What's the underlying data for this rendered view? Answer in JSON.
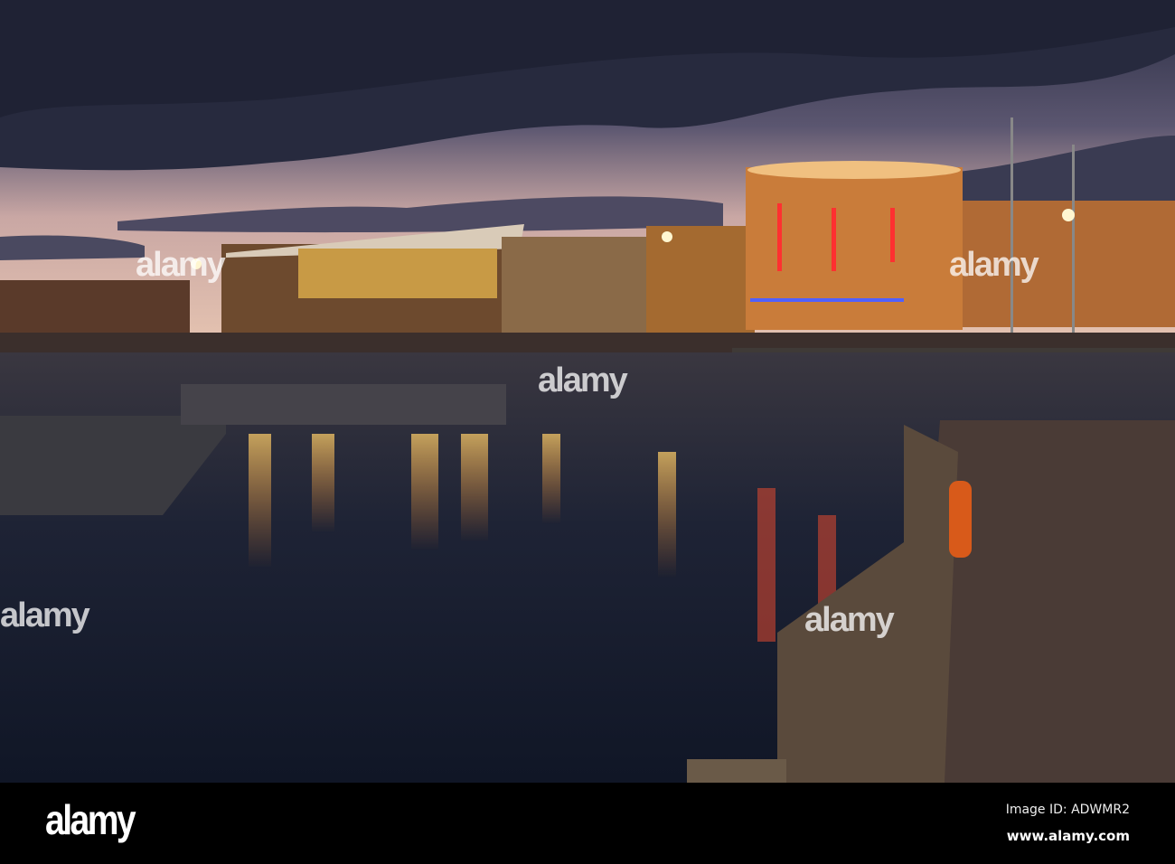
{
  "footer": {
    "logo": "alamy",
    "image_id": "Image ID: ADWMR2",
    "website": "www.alamy.com"
  },
  "watermark": "alamy"
}
